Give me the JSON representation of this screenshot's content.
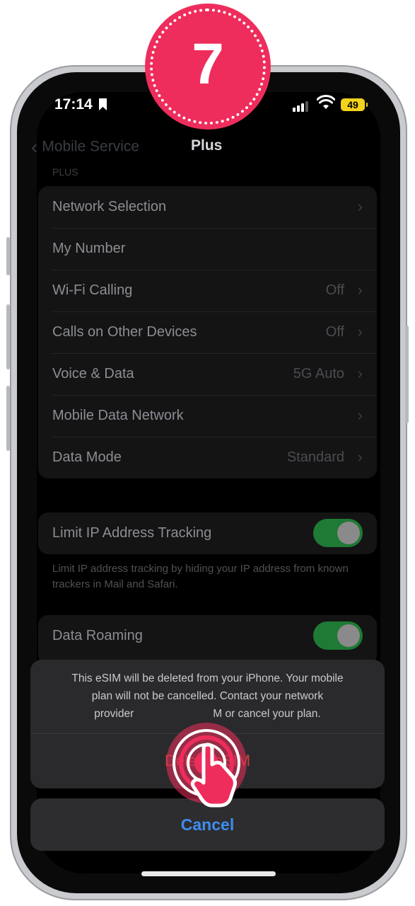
{
  "step": {
    "number": "7"
  },
  "status_bar": {
    "time": "17:14",
    "battery": "49"
  },
  "nav": {
    "back_label": "Mobile Service",
    "title": "Plus"
  },
  "section": {
    "label": "PLUS"
  },
  "settings_group": {
    "rows": [
      {
        "label": "Network Selection",
        "value": "",
        "chevron": true
      },
      {
        "label": "My Number",
        "value": "",
        "chevron": false
      },
      {
        "label": "Wi-Fi Calling",
        "value": "Off",
        "chevron": true
      },
      {
        "label": "Calls on Other Devices",
        "value": "Off",
        "chevron": true
      },
      {
        "label": "Voice & Data",
        "value": "5G Auto",
        "chevron": true
      },
      {
        "label": "Mobile Data Network",
        "value": "",
        "chevron": true
      },
      {
        "label": "Data Mode",
        "value": "Standard",
        "chevron": true
      }
    ]
  },
  "limit_ip": {
    "label": "Limit IP Address Tracking",
    "enabled": true,
    "footnote": "Limit IP address tracking by hiding your IP address from known trackers in Mail and Safari."
  },
  "data_roaming": {
    "label": "Data Roaming",
    "enabled": true
  },
  "action_sheet": {
    "message_line1": "This eSIM will be deleted from your iPhone. Your mobile",
    "message_line2": "plan will not be cancelled. Contact your network",
    "message_line3": "provider                          M or cancel your plan.",
    "delete_label": "Delete eSIM",
    "cancel_label": "Cancel"
  },
  "colors": {
    "accent_blue": "#3f8cf0",
    "destructive_red": "#c7443c",
    "toggle_green": "#1e7a34",
    "badge_pink": "#ee2d5c"
  },
  "icons": [
    "bookmark-icon",
    "signal-icon",
    "wifi-icon",
    "battery-icon",
    "chevron-left-icon",
    "chevron-right-icon",
    "tap-hand-icon"
  ]
}
